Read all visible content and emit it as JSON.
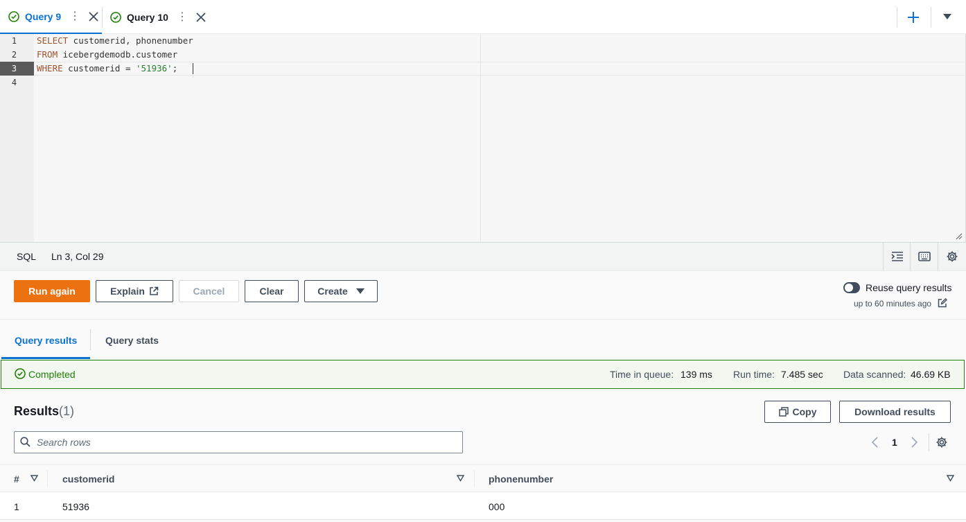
{
  "tabs": [
    {
      "label": "Query 9",
      "active": true
    },
    {
      "label": "Query 10",
      "active": false
    }
  ],
  "editor": {
    "lines": [
      {
        "num": "1",
        "tokens": [
          {
            "t": "SELECT",
            "c": "kw2"
          },
          {
            "t": " customerid, phonenumber",
            "c": "op"
          }
        ]
      },
      {
        "num": "2",
        "tokens": [
          {
            "t": "FROM",
            "c": "kw2"
          },
          {
            "t": " icebergdemodb.customer",
            "c": "op"
          }
        ]
      },
      {
        "num": "3",
        "tokens": [
          {
            "t": "WHERE",
            "c": "kw2"
          },
          {
            "t": " customerid = ",
            "c": "op"
          },
          {
            "t": "'51936'",
            "c": "str"
          },
          {
            "t": ";",
            "c": "op"
          }
        ]
      },
      {
        "num": "4",
        "tokens": []
      }
    ],
    "active_line": 3
  },
  "statusbar": {
    "language": "SQL",
    "cursor": "Ln 3, Col 29"
  },
  "actions": {
    "run_again": "Run again",
    "explain": "Explain",
    "cancel": "Cancel",
    "clear": "Clear",
    "create": "Create",
    "reuse_label": "Reuse query results",
    "reuse_sub": "up to 60 minutes ago"
  },
  "result_tabs": {
    "results": "Query results",
    "stats": "Query stats"
  },
  "banner": {
    "status": "Completed",
    "queue_label": "Time in queue:",
    "queue_value": "139 ms",
    "run_label": "Run time:",
    "run_value": "7.485 sec",
    "scanned_label": "Data scanned:",
    "scanned_value": "46.69 KB"
  },
  "results": {
    "title": "Results",
    "count": "(1)",
    "copy": "Copy",
    "download": "Download results",
    "search_placeholder": "Search rows",
    "page": "1",
    "columns": [
      "#",
      "customerid",
      "phonenumber"
    ],
    "rows": [
      [
        "1",
        "51936",
        "000"
      ]
    ]
  },
  "colors": {
    "primary": "#ec7211",
    "accent": "#0972d3",
    "success": "#1d8102"
  }
}
